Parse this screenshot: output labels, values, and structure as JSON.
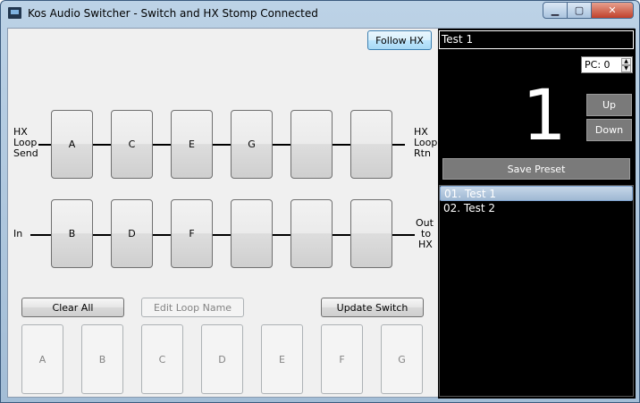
{
  "window": {
    "title": "Kos Audio Switcher - Switch and HX Stomp Connected"
  },
  "controls": {
    "minimize": "▁",
    "maximize": "▢",
    "close": "✕"
  },
  "toolbar": {
    "follow_hx": "Follow HX"
  },
  "labels": {
    "hx_loop_send": [
      "HX",
      "Loop",
      "Send"
    ],
    "hx_loop_rtn": [
      "HX",
      "Loop",
      "Rtn"
    ],
    "in": "In",
    "out_to_hx": [
      "Out",
      "to",
      "HX"
    ]
  },
  "loops_top": [
    "A",
    "C",
    "E",
    "G",
    "",
    ""
  ],
  "loops_bottom": [
    "B",
    "D",
    "F",
    "",
    "",
    ""
  ],
  "actions": {
    "clear_all": "Clear All",
    "edit_loop_name": "Edit Loop Name",
    "update_switch": "Update Switch"
  },
  "edit_buttons": [
    "A",
    "B",
    "C",
    "D",
    "E",
    "F",
    "G"
  ],
  "preset": {
    "name": "Test 1",
    "pc_label": "PC: 0",
    "number": "1",
    "up": "Up",
    "down": "Down",
    "save": "Save Preset",
    "list": [
      "01. Test 1",
      "02. Test 2"
    ],
    "selected_index": 0
  }
}
